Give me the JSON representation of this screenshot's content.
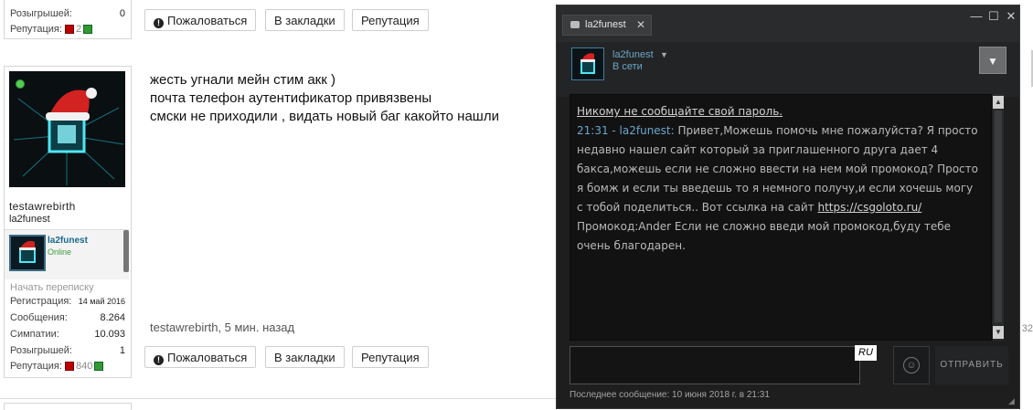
{
  "top_block": {
    "rows": [
      {
        "label": "Розыгрышей:",
        "value": "0"
      },
      {
        "label": "Репутация:",
        "value": "2"
      }
    ]
  },
  "actions": {
    "report": "Пожаловаться",
    "bookmark": "В закладки",
    "reputation": "Репутация"
  },
  "post": {
    "lines": [
      "жесть угнали мейн стим акк )",
      "почта телефон аутентификатор привязвены",
      "смски не приходили , видать новый баг какойто нашли"
    ],
    "meta": "testawrebirth, 5 мин. назад"
  },
  "user": {
    "name": "testawrebirth",
    "title": "la2funest",
    "steam_name": "la2funest",
    "steam_status": "Online",
    "start_conversation": "Начать переписку",
    "stats": [
      {
        "label": "Регистрация:",
        "value": "14 май 2016"
      },
      {
        "label": "Сообщения:",
        "value": "8.264"
      },
      {
        "label": "Симпатии:",
        "value": "10.093"
      },
      {
        "label": "Розыгрышей:",
        "value": "1"
      },
      {
        "label": "Репутация:",
        "value": "840"
      }
    ]
  },
  "side_number": "32",
  "chat": {
    "tab_name": "la2funest",
    "friend_name": "la2funest",
    "friend_status": "В сети",
    "warning": "Никому не сообщайте свой пароль.",
    "message_time": "21:31 - la2funest:",
    "message_text": "Привет,Можешь помочь мне пожалуйста? Я просто недавно нашел сайт который за приглашенного друга дает 4 бакса,можешь если не сложно ввести на нем мой промокод? Просто я бомж и если ты введешь то я немного получу,и если хочешь могу с тобой поделиться.. Вот ссылка на сайт",
    "link": "https://csgoloto.ru/",
    "promo_text": "Промокод:Ander Если не сложно введи мой промокод,буду тебе очень благодарен.",
    "lang": "RU",
    "send": "ОТПРАВИТЬ",
    "last_message": "Последнее сообщение: 10 июня 2018 г. в 21:31"
  },
  "icons": [
    "report-icon",
    "chat-bubble-icon",
    "close-icon",
    "minimize-icon",
    "maximize-icon",
    "emoji-icon",
    "dropdown-icon"
  ]
}
